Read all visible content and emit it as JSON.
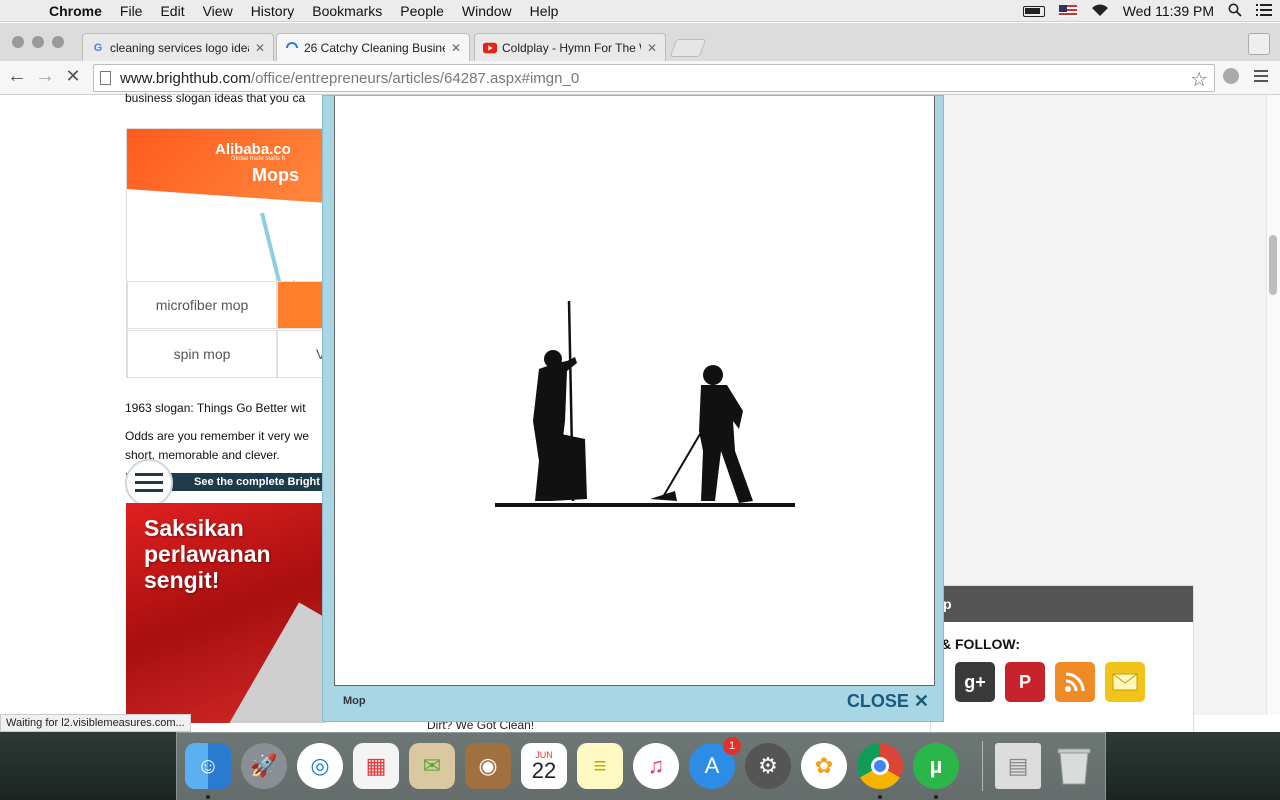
{
  "menubar": {
    "app": "Chrome",
    "items": [
      "File",
      "Edit",
      "View",
      "History",
      "Bookmarks",
      "People",
      "Window",
      "Help"
    ],
    "clock": "Wed 11:39 PM"
  },
  "tabs": [
    {
      "title": "cleaning services logo idea",
      "favicon": "google-icon"
    },
    {
      "title": "26 Catchy Cleaning Busine",
      "favicon": "loading-icon"
    },
    {
      "title": "Coldplay - Hymn For The W",
      "favicon": "youtube-icon"
    }
  ],
  "toolbar": {
    "url_host": "www.brighthub.com",
    "url_path": "/office/entrepreneurs/articles/64287.aspx#imgn_0"
  },
  "article": {
    "top_text": "business slogan ideas that you ca",
    "slogan_line": "1963 slogan: Things Go Better wit",
    "para_line1": "Odds are you remember it very we",
    "para_line2": "short, memorable and clever.",
    "bar_text": "See the complete Bright",
    "bottom_text": "Dirt? We Got Clean!"
  },
  "ad_alibaba": {
    "brand": "Alibaba.co",
    "tagline": "Global trade starts h",
    "heading": "Mops",
    "cells": [
      "microfiber mop",
      "",
      "spin mop",
      "V"
    ]
  },
  "ad_red": {
    "text": "Saksikan\nperlawanan\nsengit!"
  },
  "follow": {
    "header": "p",
    "label": "& FOLLOW:"
  },
  "modal": {
    "caption": "Mop",
    "close_label": "CLOSE ✕"
  },
  "status": "Waiting for l2.visiblemeasures.com...",
  "dock": {
    "calendar_month": "JUN",
    "calendar_day": "22",
    "appstore_badge": "1"
  }
}
